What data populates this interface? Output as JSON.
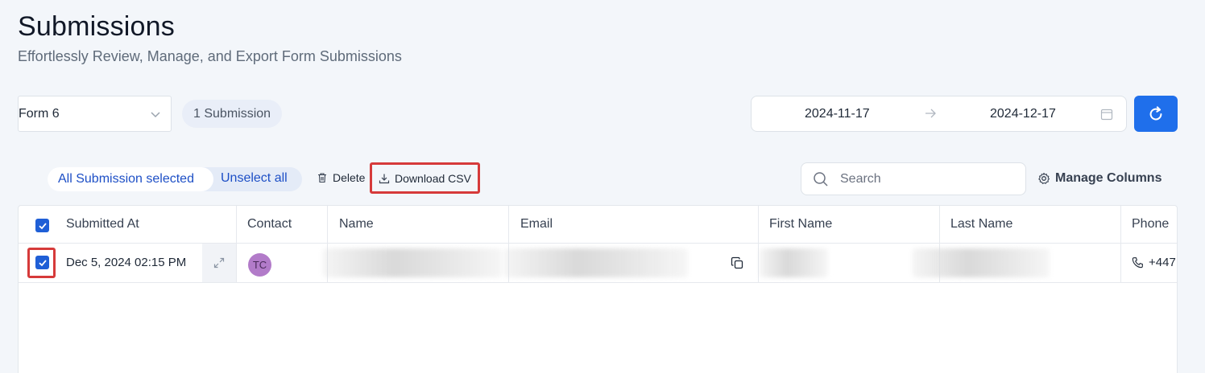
{
  "header": {
    "title": "Submissions",
    "subtitle": "Effortlessly Review, Manage, and Export Form Submissions"
  },
  "filters": {
    "form_select_value": "Form 6",
    "submission_count": "1 Submission",
    "date_start": "2024-11-17",
    "date_end": "2024-12-17"
  },
  "toolbar": {
    "selection_label": "All Submission selected",
    "unselect_label": "Unselect all",
    "delete_label": "Delete",
    "download_label": "Download CSV",
    "search_placeholder": "Search",
    "manage_columns_label": "Manage Columns"
  },
  "table": {
    "columns": [
      "Submitted At",
      "Contact",
      "Name",
      "Email",
      "First Name",
      "Last Name",
      "Phone"
    ],
    "rows": [
      {
        "submitted_at": "Dec 5, 2024  02:15 PM",
        "contact_initials": "TC",
        "phone": "+447"
      }
    ]
  },
  "colors": {
    "accent": "#1f6feb",
    "checkbox": "#1f5fd6",
    "highlight": "#d63a3a",
    "avatar": "#b27bc9"
  }
}
